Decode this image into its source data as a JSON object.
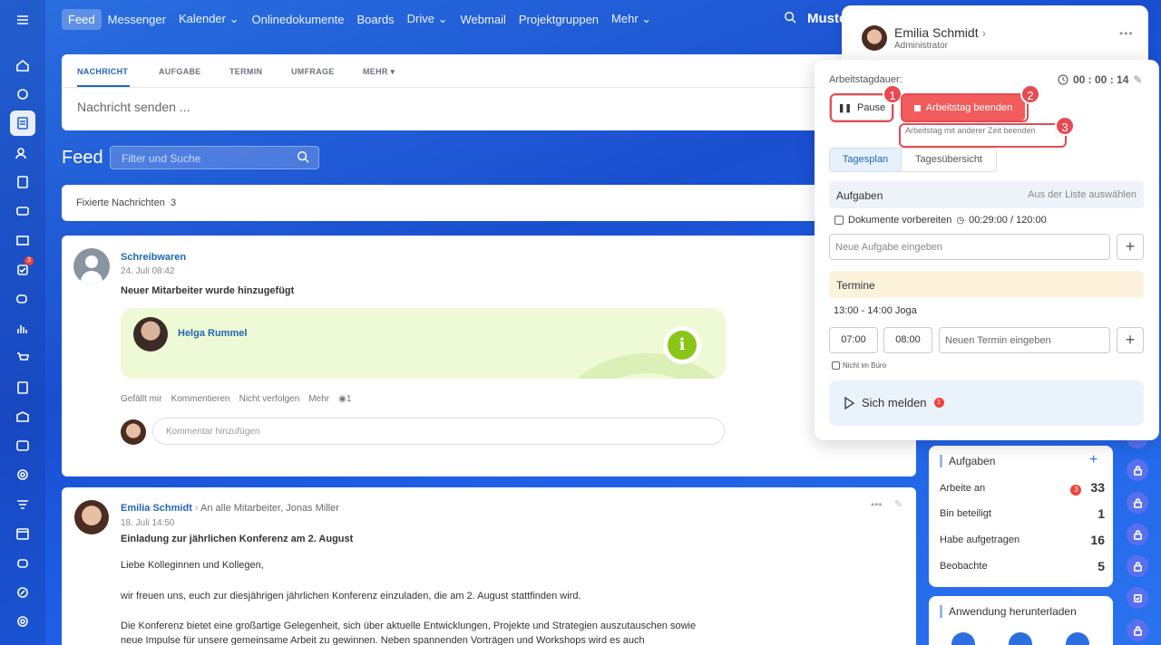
{
  "nav": {
    "items": [
      "Feed",
      "Messenger",
      "Kalender",
      "Onlinedokumente",
      "Boards",
      "Drive",
      "Webmail",
      "Projektgruppen",
      "Mehr"
    ],
    "search_text": "Muste"
  },
  "rail": {
    "tasks_badge": "3"
  },
  "composer": {
    "tabs": [
      "NACHRICHT",
      "AUFGABE",
      "TERMIN",
      "UMFRAGE",
      "MEHR"
    ],
    "placeholder": "Nachricht senden ..."
  },
  "feed": {
    "title": "Feed",
    "filter_placeholder": "Filter und Suche",
    "pinned_label": "Fixierte Nachrichten",
    "pinned_count": "3"
  },
  "post1": {
    "author": "Schreibwaren",
    "date": "24. Juli 08:42",
    "title": "Neuer Mitarbeiter wurde hinzugefügt",
    "card_name": "Helga Rummel",
    "actions": [
      "Gefällt mir",
      "Kommentieren",
      "Nicht verfolgen",
      "Mehr"
    ],
    "views": "1",
    "comment_placeholder": "Kommentar hinzufügen"
  },
  "post2": {
    "author": "Emilia Schmidt",
    "recipients": "An alle Mitarbeiter, Jonas Miller",
    "date": "18. Juli 14:50",
    "title": "Einladung zur jährlichen Konferenz am 2. August",
    "lines": [
      "Liebe Kolleginnen und Kollegen,",
      "wir freuen uns, euch zur diesjährigen jährlichen Konferenz einzuladen, die am 2. August stattfinden wird.",
      "Die Konferenz bietet eine großartige Gelegenheit, sich über aktuelle Entwicklungen, Projekte und Strategien auszutauschen sowie",
      "neue Impulse für unsere gemeinsame Arbeit zu gewinnen. Neben spannenden Vorträgen und Workshops wird es auch"
    ]
  },
  "tasks_widget": {
    "title": "Aufgaben",
    "rows": [
      {
        "label": "Arbeite an",
        "badge": "3",
        "count": "33"
      },
      {
        "label": "Bin beteiligt",
        "count": "1"
      },
      {
        "label": "Habe aufgetragen",
        "count": "16"
      },
      {
        "label": "Beobachte",
        "count": "5"
      }
    ]
  },
  "app_widget": {
    "title": "Anwendung herunterladen"
  },
  "user": {
    "name": "Emilia Schmidt",
    "role": "Administrator"
  },
  "worktime": {
    "label": "Arbeitstagdauer:",
    "time": "00 : 00 : 14",
    "pause": "Pause",
    "end": "Arbeitstag beenden",
    "other_time": "Arbeitstag mit anderer Zeit beenden",
    "tabs": [
      "Tagesplan",
      "Tagesübersicht"
    ],
    "tasks_title": "Aufgaben",
    "tasks_link": "Aus der Liste auswählen",
    "task_item": "Dokumente vorbereiten",
    "task_time": "00:29:00 / 120:00",
    "task_placeholder": "Neue Aufgabe eingeben",
    "termine_title": "Termine",
    "termin_item": "13:00 - 14:00  Joga",
    "time_from": "07:00",
    "time_to": "08:00",
    "termin_placeholder": "Neuen Termin eingeben",
    "not_office": "Nicht im Büro",
    "report": "Sich melden",
    "report_badge": "1",
    "markers": [
      "1",
      "2",
      "3"
    ]
  },
  "colors": {
    "accent": "#2067b0",
    "danger": "#f25c5c",
    "highlight": "#e74a53"
  }
}
